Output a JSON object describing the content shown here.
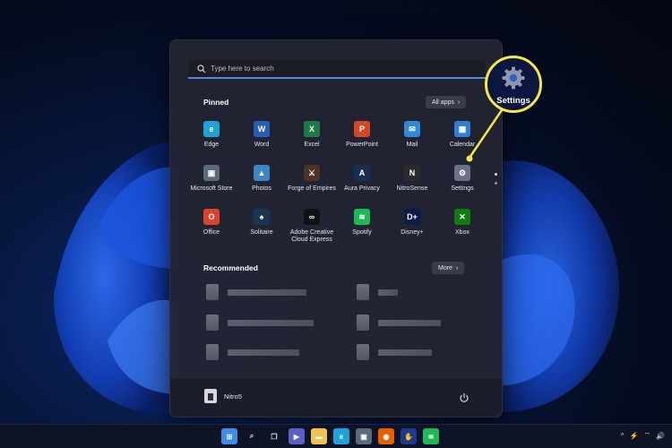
{
  "search": {
    "placeholder": "Type here to search"
  },
  "pinned": {
    "title": "Pinned",
    "all_apps_label": "All apps",
    "apps": [
      {
        "label": "Edge",
        "icon": "edge-icon",
        "color": "#1fa1d9",
        "glyph": "e"
      },
      {
        "label": "Word",
        "icon": "word-icon",
        "color": "#2b5db8",
        "glyph": "W"
      },
      {
        "label": "Excel",
        "icon": "excel-icon",
        "color": "#1d7a44",
        "glyph": "X"
      },
      {
        "label": "PowerPoint",
        "icon": "powerpoint-icon",
        "color": "#d24726",
        "glyph": "P"
      },
      {
        "label": "Mail",
        "icon": "mail-icon",
        "color": "#2f8ad8",
        "glyph": "✉"
      },
      {
        "label": "Calendar",
        "icon": "calendar-icon",
        "color": "#2f7fd6",
        "glyph": "▦"
      },
      {
        "label": "Microsoft Store",
        "icon": "store-icon",
        "color": "#5c6a7a",
        "glyph": "▣"
      },
      {
        "label": "Photos",
        "icon": "photos-icon",
        "color": "#3f86c7",
        "glyph": "▲"
      },
      {
        "label": "Forge of Empires",
        "icon": "forge-of-empires-icon",
        "color": "#4a3324",
        "glyph": "⚔"
      },
      {
        "label": "Aura Privacy",
        "icon": "aura-privacy-icon",
        "color": "#1a2e52",
        "glyph": "A"
      },
      {
        "label": "NitroSense",
        "icon": "nitrosense-icon",
        "color": "#2a2a2a",
        "glyph": "N"
      },
      {
        "label": "Settings",
        "icon": "settings-gear-icon",
        "color": "#6a7285",
        "glyph": "⚙"
      },
      {
        "label": "Office",
        "icon": "office-icon",
        "color": "#e0412b",
        "glyph": "O"
      },
      {
        "label": "Solitaire",
        "icon": "solitaire-icon",
        "color": "#1b3552",
        "glyph": "♠"
      },
      {
        "label": "Adobe Creative Cloud Express",
        "icon": "adobe-express-icon",
        "color": "#111111",
        "glyph": "∞"
      },
      {
        "label": "Spotify",
        "icon": "spotify-icon",
        "color": "#1db954",
        "glyph": "≋"
      },
      {
        "label": "Disney+",
        "icon": "disney-plus-icon",
        "color": "#0d1d4a",
        "glyph": "D+"
      },
      {
        "label": "Xbox",
        "icon": "xbox-icon",
        "color": "#107c10",
        "glyph": "✕"
      }
    ]
  },
  "recommended": {
    "title": "Recommended",
    "more_label": "More"
  },
  "user": {
    "name": "Nitro5"
  },
  "callout": {
    "label": "Settings",
    "color": "#f2e84a"
  },
  "taskbar": {
    "icons": [
      {
        "name": "start-icon",
        "color": "#3d8bea",
        "glyph": "⊞"
      },
      {
        "name": "search-icon",
        "color": "transparent",
        "glyph": "⌕"
      },
      {
        "name": "task-view-icon",
        "color": "transparent",
        "glyph": "❐"
      },
      {
        "name": "teams-chat-icon",
        "color": "#5b5fc7",
        "glyph": "▶"
      },
      {
        "name": "file-explorer-icon",
        "color": "#f2c14e",
        "glyph": "▬"
      },
      {
        "name": "edge-icon",
        "color": "#1fa1d9",
        "glyph": "e"
      },
      {
        "name": "store-icon",
        "color": "#5c6a7a",
        "glyph": "▣"
      },
      {
        "name": "firefox-icon",
        "color": "#e66000",
        "glyph": "◉"
      },
      {
        "name": "dolby-icon",
        "color": "#1a3b8f",
        "glyph": "✋"
      },
      {
        "name": "spotify-icon",
        "color": "#1db954",
        "glyph": "≋"
      }
    ],
    "tray": [
      "^",
      "⚡",
      "⌔",
      "🔊"
    ]
  }
}
